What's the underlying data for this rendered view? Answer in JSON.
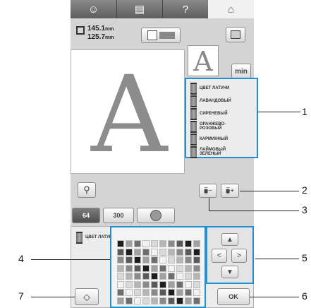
{
  "tabs": [
    "☺",
    "▤",
    "?",
    "⌂"
  ],
  "size": {
    "height": "145.1",
    "width": "125.7",
    "unit": "mm"
  },
  "preview_letter": "A",
  "min_label": "min",
  "thread_list": [
    "ЦВЕТ ЛАТУНИ",
    "ЛАВАНДОВЫЙ",
    "СИРЕНЕВЫЙ",
    "ОРАНЖЕВО-\nРОЗОВЫЙ",
    "КАРМИННЫЙ",
    "ЛАЙМОВЫЙ\nЗЕЛЕНЫЙ"
  ],
  "palette_buttons": {
    "left": "64",
    "mid": "300"
  },
  "selected_thread": "ЦВЕТ ЛАТУНИ",
  "ok_label": "OK",
  "callouts": [
    "1",
    "2",
    "3",
    "4",
    "5",
    "6",
    "7"
  ],
  "colors": {
    "callout_box": "#1f8fd6",
    "screen_bg": "#d4d4d4"
  }
}
